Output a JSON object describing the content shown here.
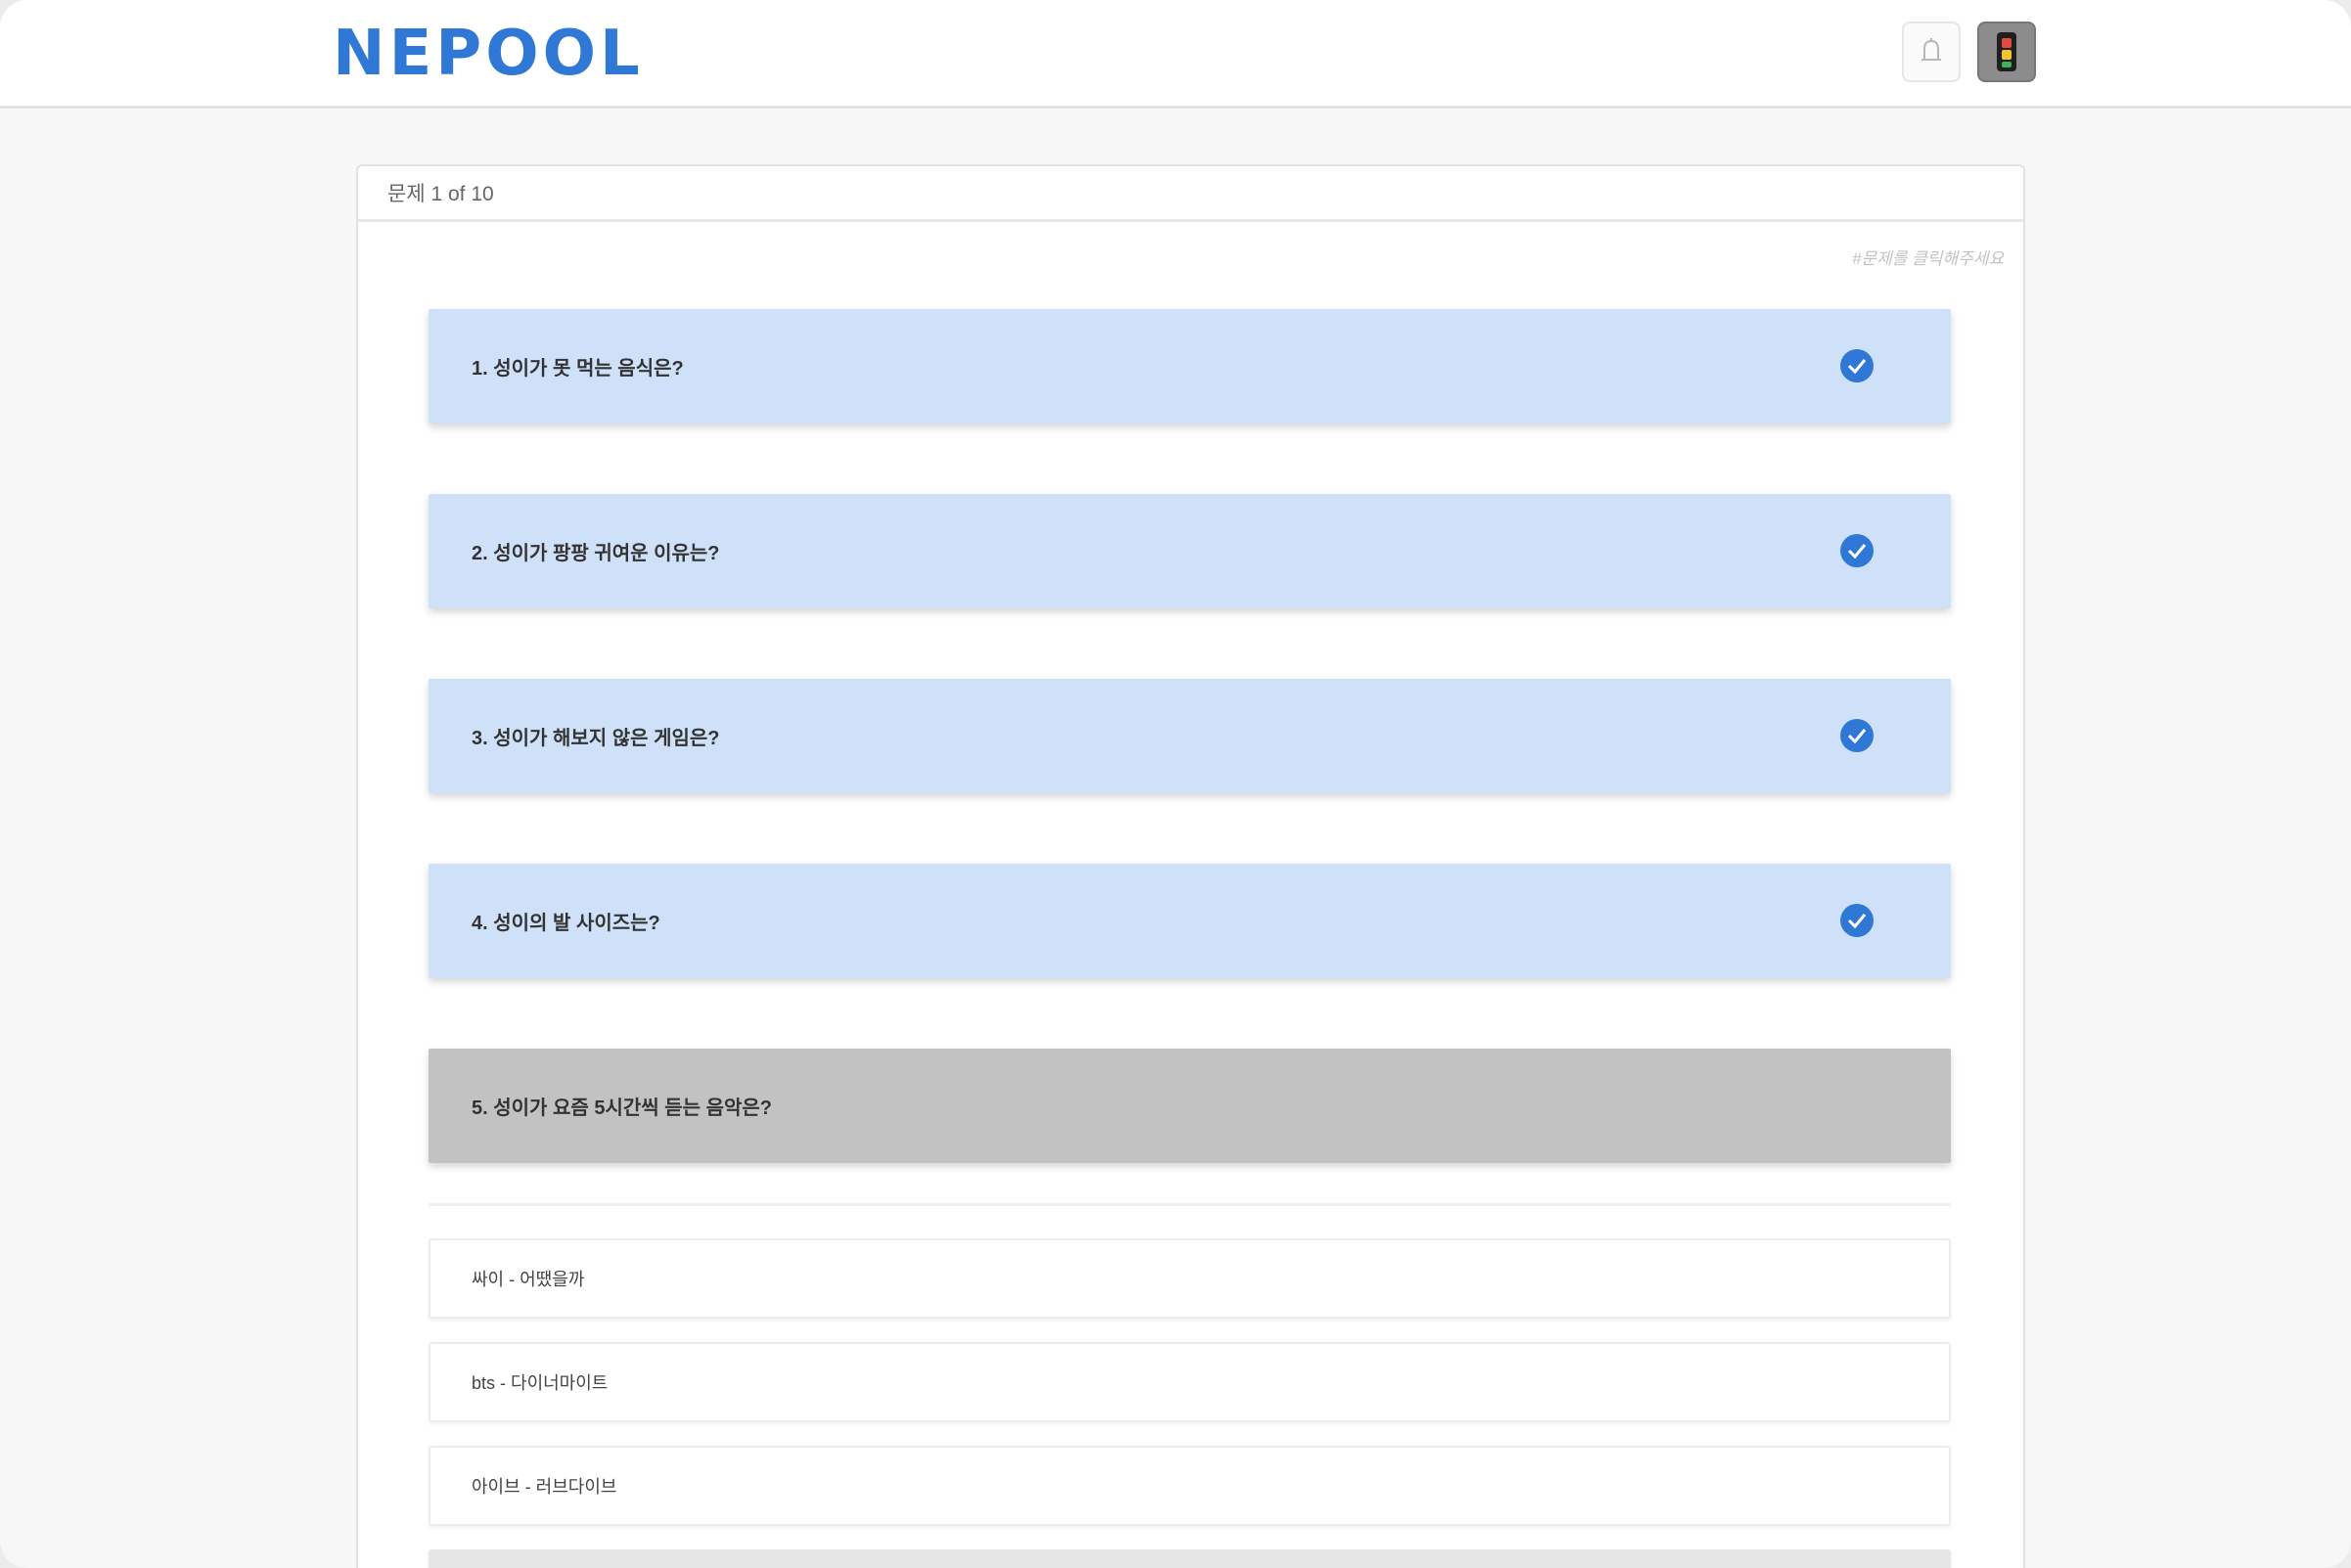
{
  "header": {
    "logo": "NEPOOL"
  },
  "quiz": {
    "progress": "문제 1 of 10",
    "hint": "#문제를 클릭해주세요",
    "questions": [
      {
        "label": "1. 성이가 못 먹는 음식은?",
        "completed": true
      },
      {
        "label": "2. 성이가 팡팡 귀여운 이유는?",
        "completed": true
      },
      {
        "label": "3. 성이가 해보지 않은 게임은?",
        "completed": true
      },
      {
        "label": "4. 성이의 발 사이즈는?",
        "completed": true
      },
      {
        "label": "5. 성이가 요즘 5시간씩 듣는 음악은?",
        "completed": false
      }
    ],
    "options": [
      {
        "label": "싸이 - 어땠을까"
      },
      {
        "label": "bts - 다이너마이트"
      },
      {
        "label": "아이브 - 러브다이브"
      }
    ]
  },
  "colors": {
    "accent": "#2f78d6",
    "question_bg": "#cfe1f9",
    "active_question_bg": "#c2c2c2",
    "check": "#2f78d6"
  },
  "icons": {
    "bell": "bell-icon",
    "avatar": "avatar-icon",
    "check": "check-circle-icon"
  }
}
